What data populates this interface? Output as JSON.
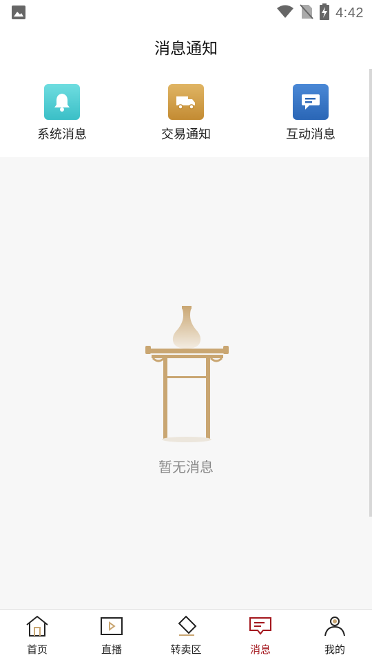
{
  "status_bar": {
    "time": "4:42"
  },
  "header": {
    "title": "消息通知"
  },
  "categories": [
    {
      "label": "系统消息",
      "icon": "bell-icon"
    },
    {
      "label": "交易通知",
      "icon": "truck-icon"
    },
    {
      "label": "互动消息",
      "icon": "chat-icon"
    }
  ],
  "empty_state": {
    "text": "暂无消息",
    "icon": "vase-on-stand-illustration"
  },
  "tabbar": {
    "items": [
      {
        "label": "首页",
        "icon": "home-icon"
      },
      {
        "label": "直播",
        "icon": "play-icon"
      },
      {
        "label": "转卖区",
        "icon": "tag-icon"
      },
      {
        "label": "消息",
        "icon": "message-icon",
        "active": true
      },
      {
        "label": "我的",
        "icon": "user-icon"
      }
    ],
    "active_color": "#a3161c"
  },
  "colors": {
    "system_tile": "#3bbfc7",
    "trade_tile": "#c38b33",
    "interact_tile": "#2a66b6"
  }
}
